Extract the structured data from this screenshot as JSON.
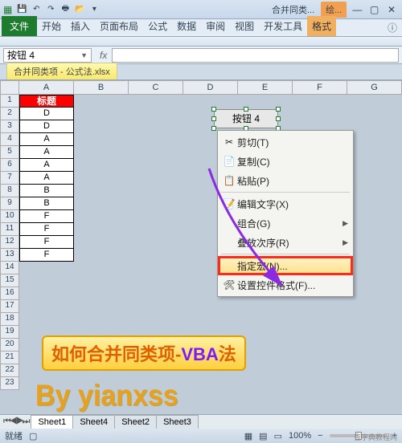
{
  "titlebar": {
    "doc": "合并同类...",
    "ctx_tab": "绘..."
  },
  "ribbon": {
    "file": "文件",
    "tabs": [
      "开始",
      "插入",
      "页面布局",
      "公式",
      "数据",
      "审阅",
      "视图",
      "开发工具"
    ],
    "ctx": "格式"
  },
  "namebox": "按钮 4",
  "fx": "fx",
  "doctab": "合并同类项 - 公式法.xlsx",
  "cols": [
    "A",
    "B",
    "C",
    "D",
    "E",
    "F",
    "G"
  ],
  "rows": [
    "1",
    "2",
    "3",
    "4",
    "5",
    "6",
    "7",
    "8",
    "9",
    "10",
    "11",
    "12",
    "13",
    "14",
    "15",
    "16",
    "17",
    "18",
    "19",
    "20",
    "21",
    "22",
    "23"
  ],
  "data_header": "标题",
  "data": [
    "D",
    "D",
    "A",
    "A",
    "A",
    "A",
    "B",
    "B",
    "F",
    "F",
    "F",
    "F"
  ],
  "button_label": "按钮 4",
  "ctxmenu": {
    "cut": "剪切(T)",
    "copy": "复制(C)",
    "paste": "粘贴(P)",
    "edit_text": "编辑文字(X)",
    "group": "组合(G)",
    "order": "叠放次序(R)",
    "assign_macro": "指定宏(N)...",
    "format_control": "设置控件格式(F)..."
  },
  "annot1_a": "如何合并同类项-",
  "annot1_b": "VBA",
  "annot1_c": "法",
  "annot2": "By yianxss",
  "sheets": [
    "Sheet1",
    "Sheet4",
    "Sheet2",
    "Sheet3"
  ],
  "status": {
    "ready": "就绪",
    "zoom": "100%"
  },
  "watermark": "查字典教程网"
}
